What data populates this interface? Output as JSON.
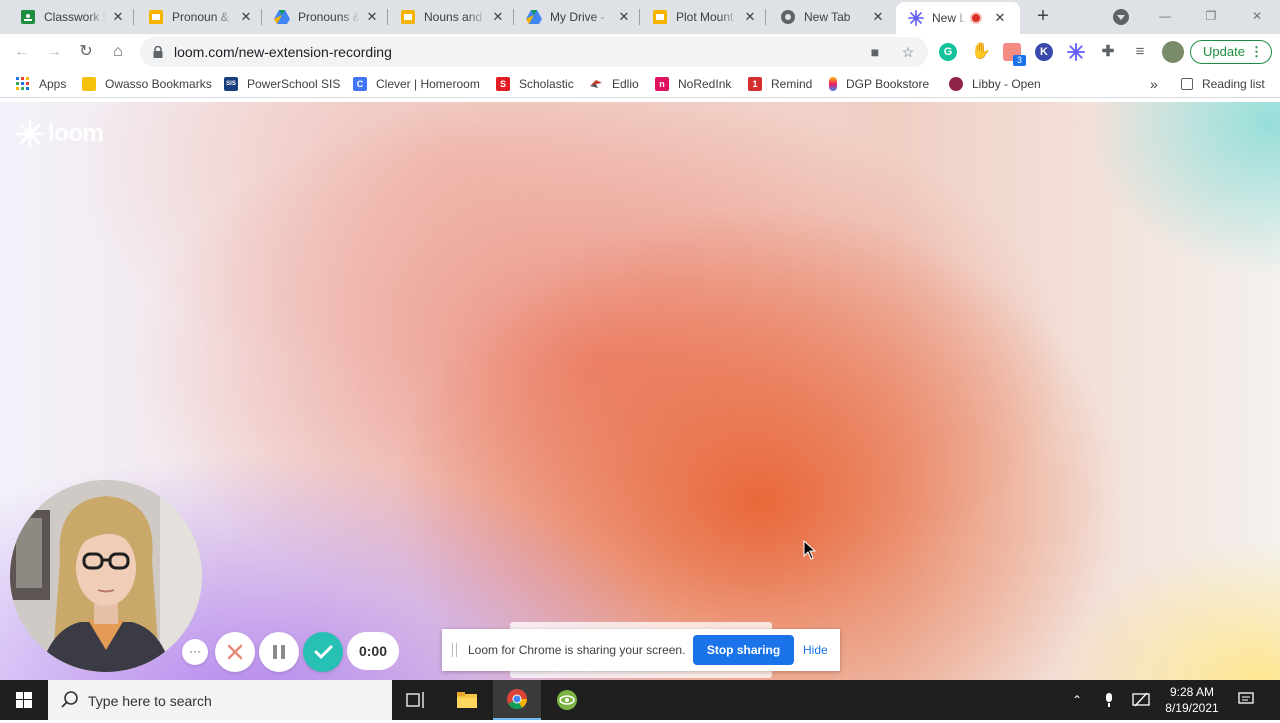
{
  "browser": {
    "tabs": [
      {
        "title": "Classwork f",
        "icon": "google-classroom-icon",
        "color": "#1e8e3e"
      },
      {
        "title": "Pronoun &",
        "icon": "google-slides-icon",
        "color": "#f4b400"
      },
      {
        "title": "Pronouns &",
        "icon": "google-drive-icon",
        "color": "#4285f4"
      },
      {
        "title": "Nouns and",
        "icon": "google-slides-icon",
        "color": "#f4b400"
      },
      {
        "title": "My Drive -",
        "icon": "google-drive-icon",
        "color": "#4285f4"
      },
      {
        "title": "Plot Mount",
        "icon": "google-slides-icon",
        "color": "#f4b400"
      },
      {
        "title": "New Tab",
        "icon": "chrome-icon",
        "color": "#5f6368"
      },
      {
        "title": "New Lo",
        "icon": "loom-icon",
        "color": "#625df5",
        "active": true,
        "recording": true
      }
    ],
    "url": "loom.com/new-extension-recording",
    "update_label": "Update",
    "extension_badge": "3",
    "bookmarks": [
      {
        "label": "Apps",
        "icon": "apps-grid-icon"
      },
      {
        "label": "Owasso Bookmarks",
        "icon": "folder-icon",
        "color": "#f4c20d"
      },
      {
        "label": "PowerSchool SIS",
        "icon": "powerschool-icon",
        "color": "#1a3d7c",
        "badge": "SIS"
      },
      {
        "label": "Clever | Homeroom",
        "icon": "clever-icon",
        "color": "#4274f6",
        "badge": "C"
      },
      {
        "label": "Scholastic",
        "icon": "scholastic-icon",
        "color": "#e31b23",
        "badge": "S"
      },
      {
        "label": "Edlio",
        "icon": "edlio-icon",
        "color": "#c0392b"
      },
      {
        "label": "NoRedInk",
        "icon": "noredink-icon",
        "color": "#e0115f",
        "badge": "n"
      },
      {
        "label": "Remind",
        "icon": "remind-icon",
        "color": "#d32f2f",
        "badge": "1"
      },
      {
        "label": "DGP Bookstore",
        "icon": "dgp-icon",
        "color": "#e91e63"
      },
      {
        "label": "Libby - Open",
        "icon": "libby-icon",
        "color": "#8e2448"
      }
    ],
    "more_bookmarks": "»",
    "reading_list": "Reading list"
  },
  "page": {
    "logo_text": "loom",
    "timer": "0:00",
    "share_bar": {
      "message": "Loom for Chrome is sharing your screen.",
      "stop_label": "Stop sharing",
      "hide_label": "Hide"
    }
  },
  "taskbar": {
    "search_placeholder": "Type here to search",
    "time": "9:28 AM",
    "date": "8/19/2021"
  }
}
